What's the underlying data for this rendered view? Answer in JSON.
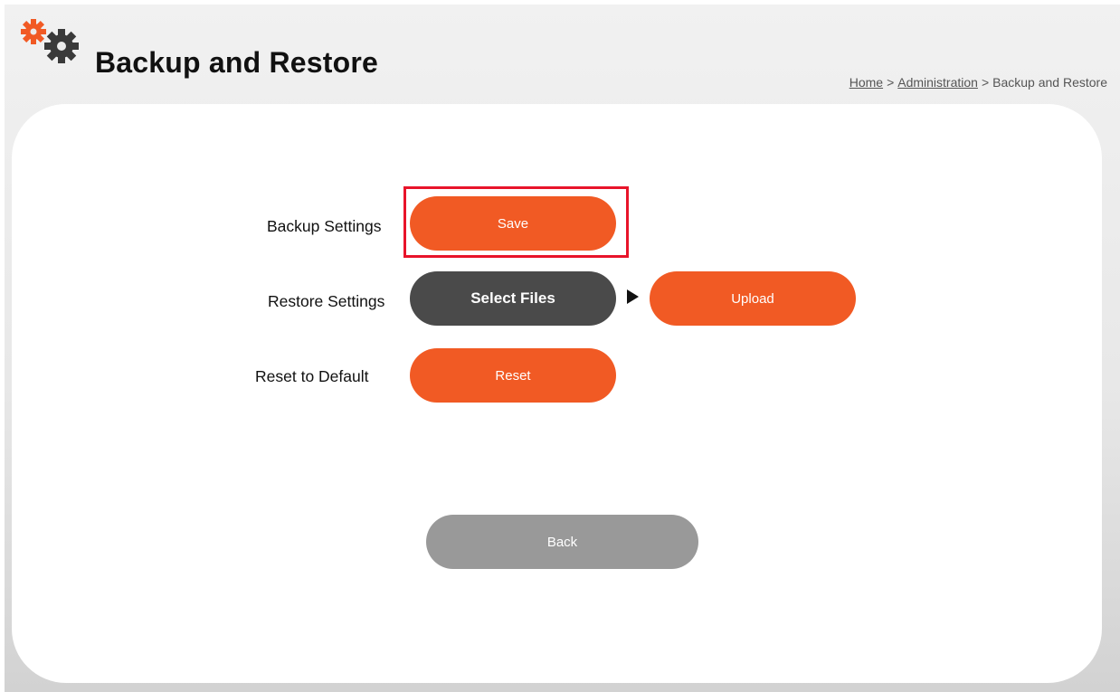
{
  "header": {
    "title": "Backup and Restore",
    "icon": "gears-icon"
  },
  "breadcrumb": {
    "home": "Home",
    "sep1": ">",
    "admin": "Administration",
    "sep2": ">",
    "current": "Backup and Restore"
  },
  "rows": {
    "backup": {
      "label": "Backup Settings",
      "button": "Save"
    },
    "restore": {
      "label": "Restore Settings",
      "select_button": "Select Files",
      "upload_button": "Upload"
    },
    "reset": {
      "label": "Reset to Default",
      "button": "Reset"
    }
  },
  "footer": {
    "back_button": "Back"
  },
  "colors": {
    "accent": "#f15a24",
    "dark_button": "#4a4a4a",
    "back_button": "#999999",
    "highlight": "#e8142a"
  }
}
